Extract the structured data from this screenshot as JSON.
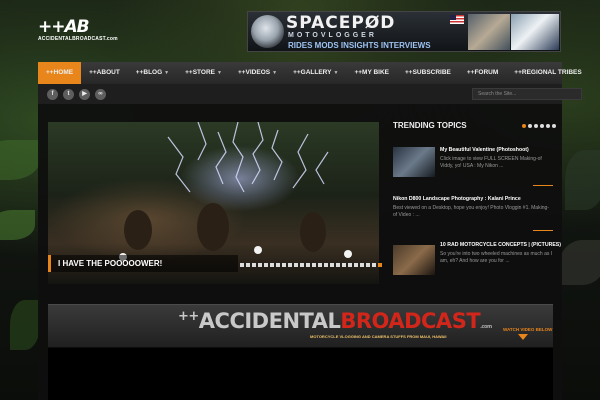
{
  "header": {
    "logo_mark": "++AB",
    "logo_sub": "ACCIDENTALBROADCAST.com",
    "banner": {
      "title": "SPACEPØD",
      "subtitle": "MOTOVLOGGER",
      "tagline": "RIDES MODS INSIGHTS INTERVIEWS"
    }
  },
  "nav": {
    "items": [
      {
        "label": "++HOME",
        "active": true,
        "dropdown": false
      },
      {
        "label": "++ABOUT",
        "active": false,
        "dropdown": false
      },
      {
        "label": "++BLOG",
        "active": false,
        "dropdown": true
      },
      {
        "label": "++STORE",
        "active": false,
        "dropdown": true
      },
      {
        "label": "++VIDEOS",
        "active": false,
        "dropdown": true
      },
      {
        "label": "++GALLERY",
        "active": false,
        "dropdown": true
      },
      {
        "label": "++MY BIKE",
        "active": false,
        "dropdown": false
      },
      {
        "label": "++SUBSCRIBE",
        "active": false,
        "dropdown": false
      },
      {
        "label": "++FORUM",
        "active": false,
        "dropdown": false
      },
      {
        "label": "++REGIONAL TRIBES",
        "active": false,
        "dropdown": false
      }
    ],
    "search_placeholder": "Search the Site..."
  },
  "social": [
    {
      "icon": "facebook-icon",
      "glyph": "f"
    },
    {
      "icon": "twitter-icon",
      "glyph": "t"
    },
    {
      "icon": "youtube-icon",
      "glyph": "▶"
    },
    {
      "icon": "flickr-icon",
      "glyph": "∞"
    }
  ],
  "slider": {
    "caption": "I HAVE THE POOOOOWER!",
    "dot_count": 24,
    "active_dot": 23
  },
  "trending": {
    "title": "TRENDING TOPICS",
    "dot_count": 6,
    "active_dot": 0,
    "items": [
      {
        "title": "My Beautiful Valentine (Photoshoot)",
        "excerpt": "Click image to view FULL SCREEN Making-of Viddy, yo! USA : My Nikon ..."
      },
      {
        "title": "Nikon D800 Landscape Photography : Kalani Prince",
        "excerpt": "Best viewed on a Desktop, hope you enjoy! Photo Vloggin #1. Making-of Video : ..."
      },
      {
        "title": "10 RAD MOTORCYCLE CONCEPTS | (PICTURES)",
        "excerpt": "So you're into two wheeled machines as much as I am, eh? And how are you for ..."
      }
    ]
  },
  "promo": {
    "logo_plus": "++",
    "logo_gray": "ACCIDENTAL",
    "logo_red": "BROADCAST",
    "logo_com": ".com",
    "tagline": "MOTORCYCLE VLOGGING AND CAMERA STUFFS FROM MAUI, HAWAII",
    "watch_label": "WATCH VIDEO BELOW"
  },
  "colors": {
    "accent": "#e8861c",
    "red": "#d2261b",
    "nav_bg": "#2f2f2f"
  }
}
